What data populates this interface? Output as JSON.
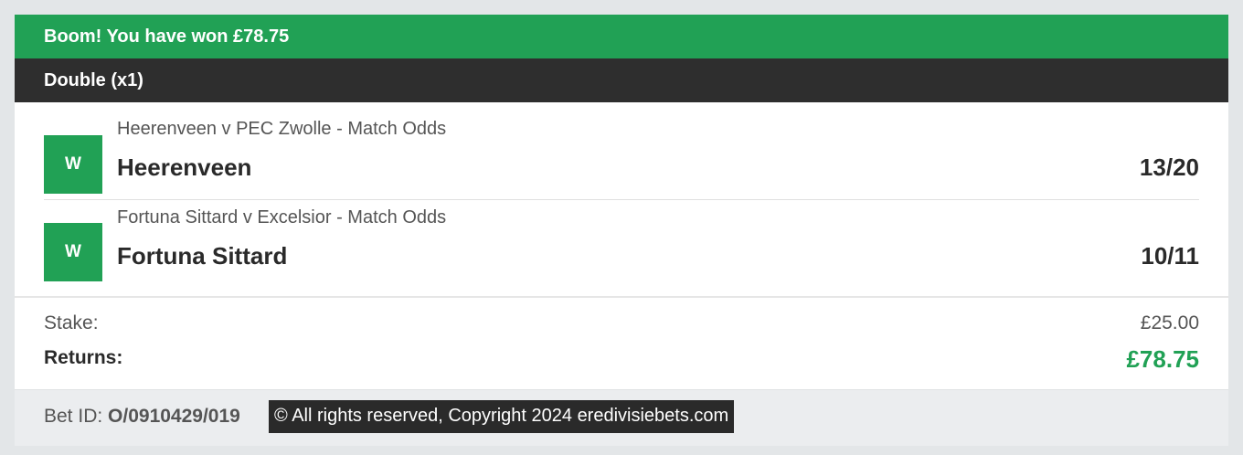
{
  "banner": {
    "text": "Boom! You have won £78.75"
  },
  "bet": {
    "type_label": "Double (x1)"
  },
  "selections": [
    {
      "result_badge": "W",
      "market": "Heerenveen v PEC Zwolle - Match Odds",
      "runner": "Heerenveen",
      "odds": "13/20"
    },
    {
      "result_badge": "W",
      "market": "Fortuna Sittard v Excelsior - Match Odds",
      "runner": "Fortuna Sittard",
      "odds": "10/11"
    }
  ],
  "summary": {
    "stake_label": "Stake:",
    "stake_value": "£25.00",
    "returns_label": "Returns:",
    "returns_value": "£78.75"
  },
  "footer": {
    "bet_id_label": "Bet ID:",
    "bet_id_value": "O/0910429/019",
    "copyright": "© All rights reserved, Copyright 2024 eredivisiebets.com"
  },
  "colors": {
    "win_green": "#21a155",
    "header_dark": "#2e2e2e",
    "page_bg": "#e3e6e8"
  }
}
